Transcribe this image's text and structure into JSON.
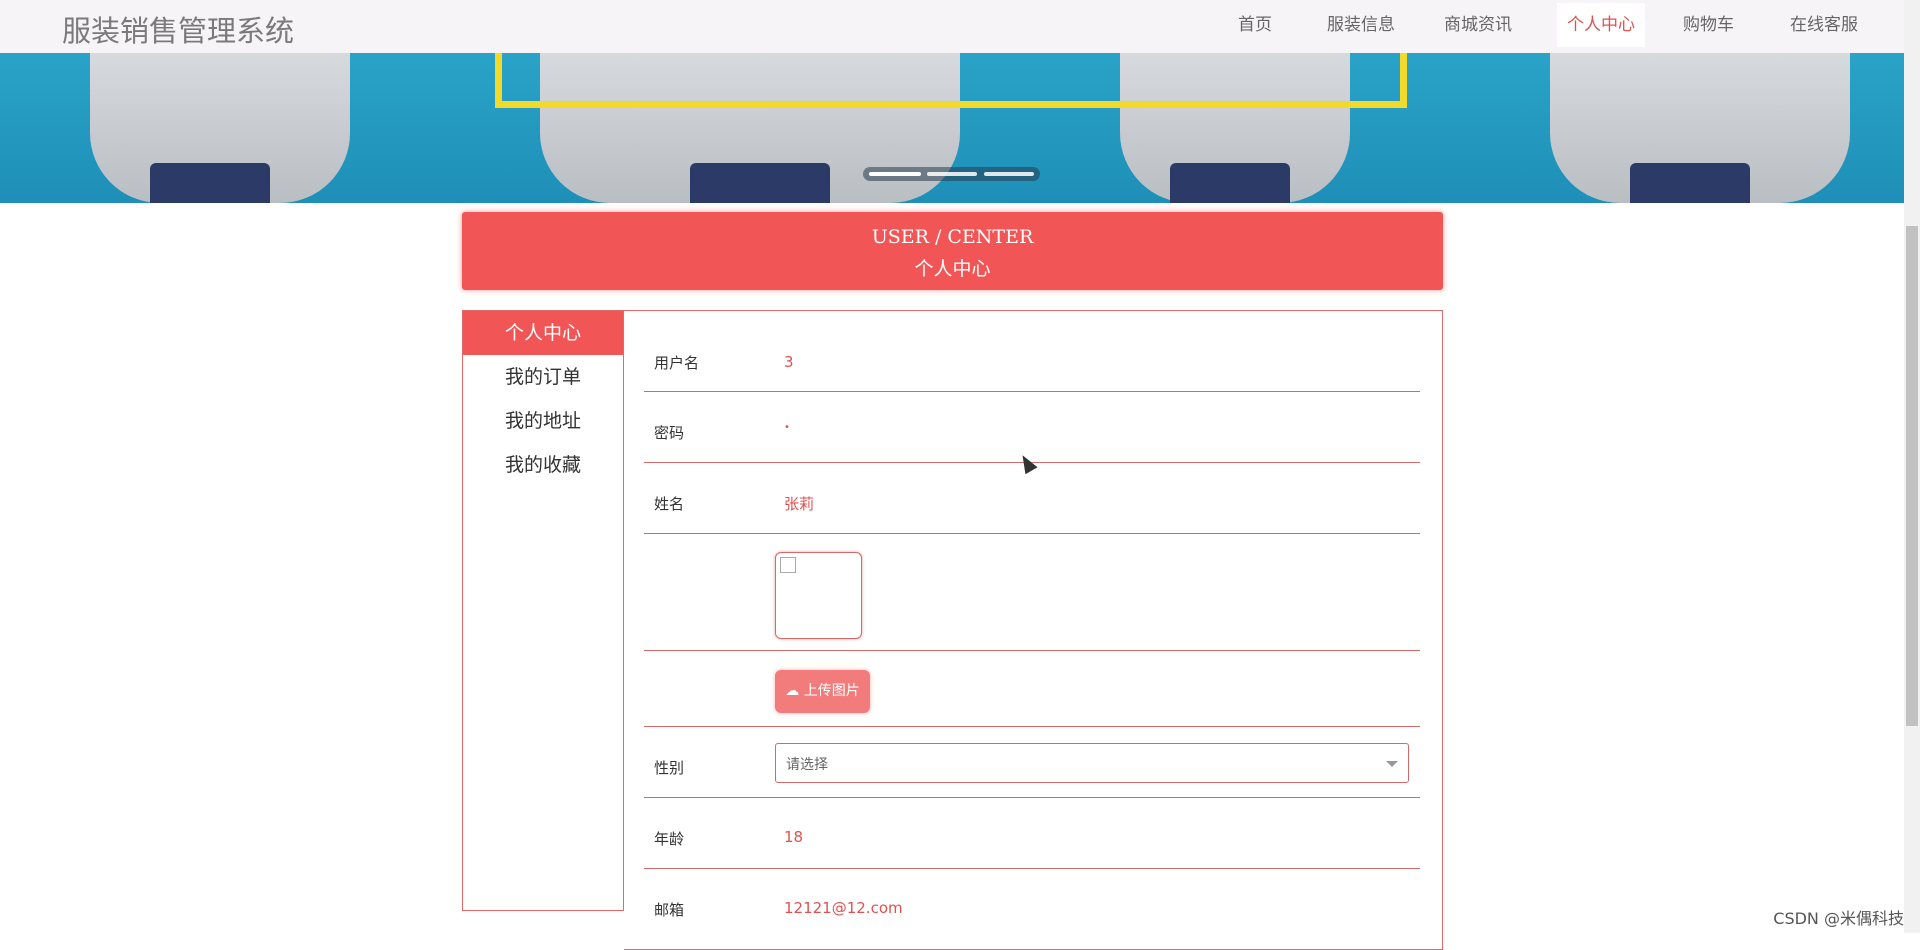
{
  "app": {
    "title": "服装销售管理系统"
  },
  "nav": {
    "items": [
      {
        "label": "首页",
        "active": false
      },
      {
        "label": "服装信息",
        "active": false
      },
      {
        "label": "商城资讯",
        "active": false
      },
      {
        "label": "个人中心",
        "active": true
      },
      {
        "label": "购物车",
        "active": false
      },
      {
        "label": "在线客服",
        "active": false
      }
    ]
  },
  "banner": {
    "slides": 3,
    "current": 1
  },
  "header": {
    "en": "USER / CENTER",
    "cn": "个人中心"
  },
  "sidebar": {
    "items": [
      {
        "label": "个人中心",
        "active": true
      },
      {
        "label": "我的订单",
        "active": false
      },
      {
        "label": "我的地址",
        "active": false
      },
      {
        "label": "我的收藏",
        "active": false
      }
    ]
  },
  "form": {
    "username": {
      "label": "用户名",
      "value": "3"
    },
    "password": {
      "label": "密码",
      "value": "•"
    },
    "name": {
      "label": "姓名",
      "value": "张莉"
    },
    "upload": {
      "label": "上传图片"
    },
    "gender": {
      "label": "性别",
      "placeholder": "请选择"
    },
    "age": {
      "label": "年龄",
      "value": "18"
    },
    "email": {
      "label": "邮箱",
      "value": "12121@12.com"
    }
  },
  "watermark": "CSDN @米偶科技",
  "colors": {
    "accent": "#f15555",
    "nav_active": "#e05252",
    "banner": "#2aa3c8"
  }
}
